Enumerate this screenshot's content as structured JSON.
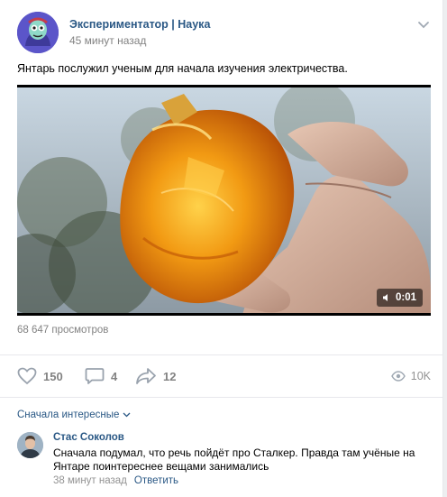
{
  "post": {
    "author": "Экспериментатор | Наука",
    "time": "45 минут назад",
    "text": "Янтарь послужил ученым для начала изучения электричества.",
    "video_duration": "0:01",
    "views_line": "68 647 просмотров"
  },
  "actions": {
    "likes": "150",
    "comments": "4",
    "shares": "12",
    "views": "10K"
  },
  "comments": {
    "sort_label": "Сначала интересные",
    "items": [
      {
        "author": "Стас Соколов",
        "text": "Сначала подумал, что речь пойдёт про Сталкер. Правда там учёные на Янтаре поинтереснее вещами занимались",
        "time": "38 минут назад",
        "reply_label": "Ответить"
      }
    ]
  },
  "colors": {
    "link": "#2a5885",
    "muted": "#828282",
    "amber": "#e98a10"
  }
}
